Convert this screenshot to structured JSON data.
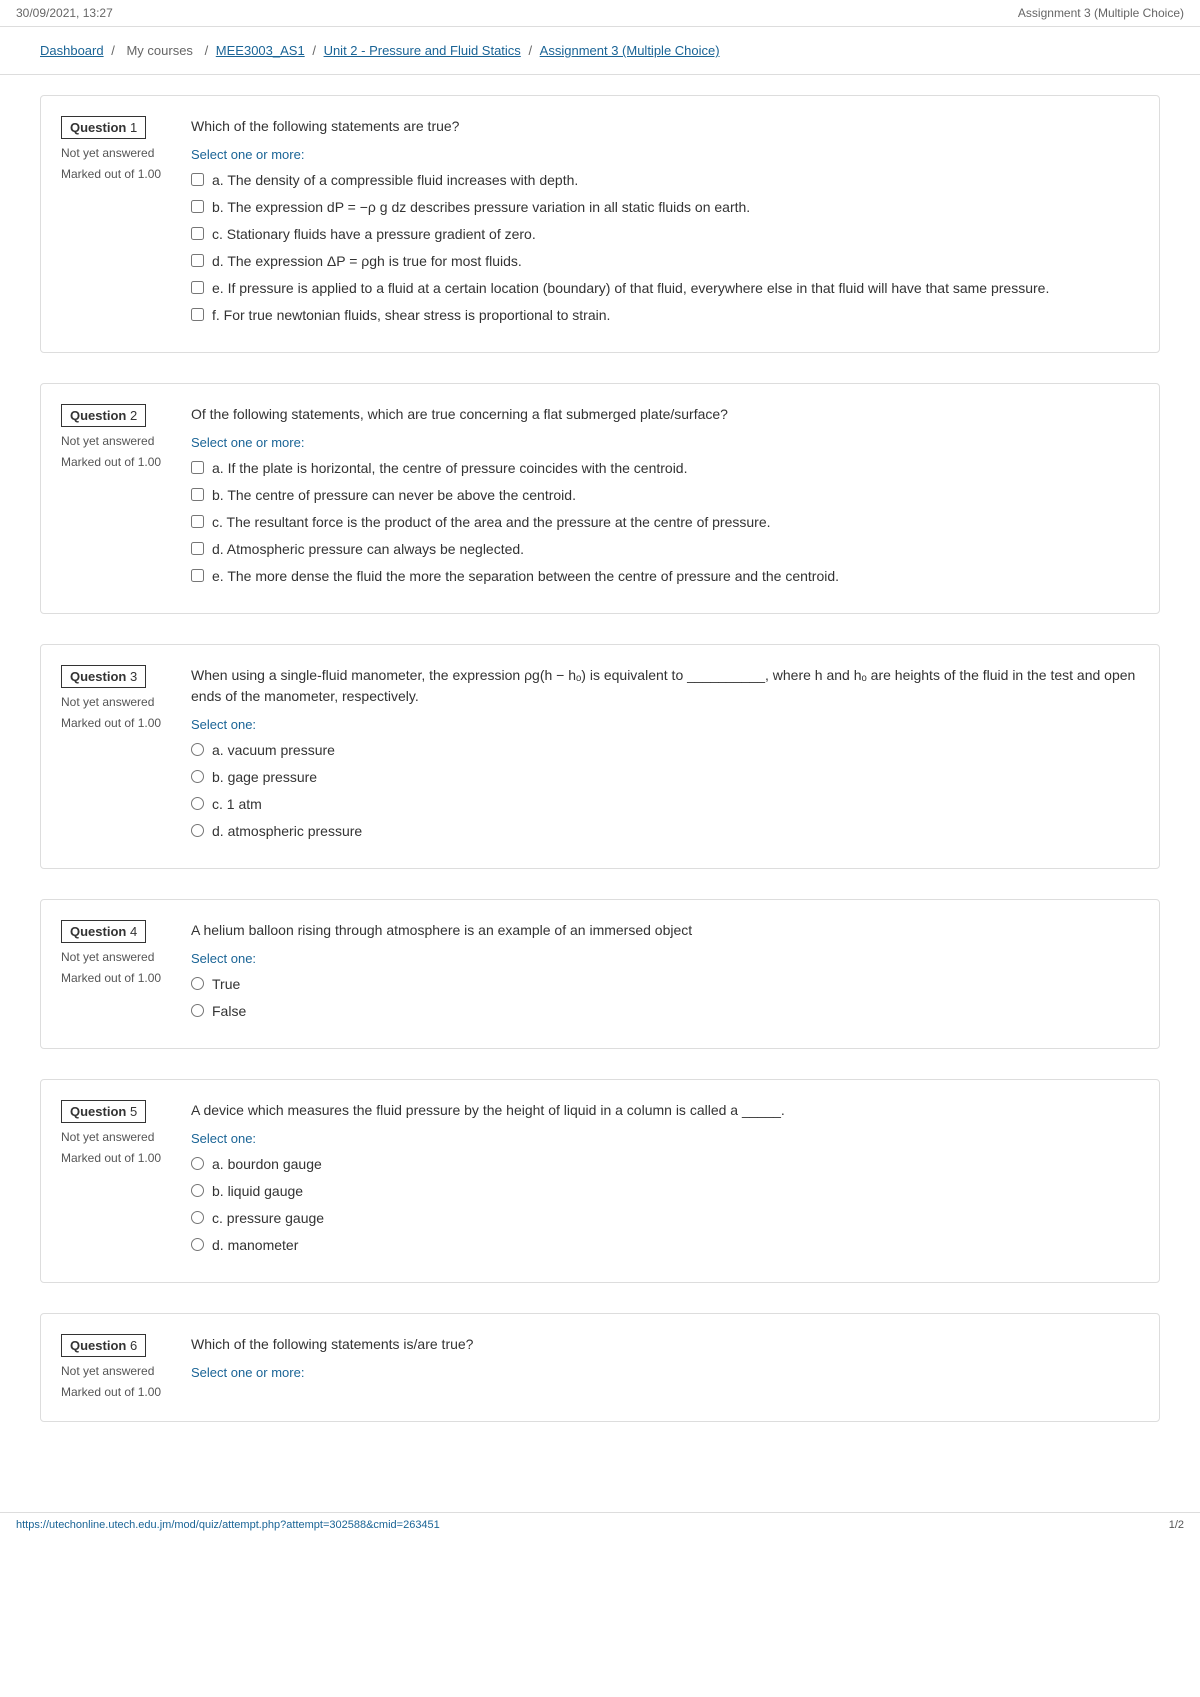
{
  "topbar": {
    "datetime": "30/09/2021, 13:27",
    "title": "Assignment 3 (Multiple Choice)"
  },
  "breadcrumb": {
    "items": [
      {
        "label": "Dashboard",
        "url": "#"
      },
      {
        "label": "My courses",
        "url": "#"
      },
      {
        "label": "MEE3003_AS1",
        "url": "#"
      },
      {
        "label": "Unit 2 - Pressure and Fluid Statics",
        "url": "#"
      },
      {
        "label": "Assignment 3 (Multiple Choice)",
        "url": "#"
      }
    ],
    "separators": [
      "/",
      "/",
      "/",
      "/"
    ]
  },
  "questions": [
    {
      "number": "1",
      "label": "Question 1",
      "status": "Not yet answered",
      "mark": "Marked out of 1.00",
      "type": "checkbox",
      "select_label": "Select one or more:",
      "text": "Which of the following statements are true?",
      "options": [
        "a. The density of a compressible fluid increases with depth.",
        "b. The expression dP = −ρ g dz describes pressure variation in all static fluids on earth.",
        "c. Stationary fluids have a pressure gradient of zero.",
        "d. The expression ΔP = ρgh is true for most fluids.",
        "e. If pressure is applied to a fluid at a certain location (boundary) of that fluid, everywhere else in that fluid will have that same pressure.",
        "f. For true newtonian fluids, shear stress is proportional to strain."
      ]
    },
    {
      "number": "2",
      "label": "Question 2",
      "status": "Not yet answered",
      "mark": "Marked out of 1.00",
      "type": "checkbox",
      "select_label": "Select one or more:",
      "text": "Of the following statements, which are true concerning a flat submerged plate/surface?",
      "options": [
        "a. If the plate is horizontal, the centre of pressure coincides with the centroid.",
        "b. The centre of pressure can never be above the centroid.",
        "c. The resultant force is the product of the area and the pressure at the centre of pressure.",
        "d. Atmospheric pressure can always be neglected.",
        "e. The more dense the fluid the more the separation between the centre of pressure and the centroid."
      ]
    },
    {
      "number": "3",
      "label": "Question 3",
      "status": "Not yet answered",
      "mark": "Marked out of 1.00",
      "type": "radio",
      "select_label": "Select one:",
      "text": "When using a single-fluid manometer, the expression ρg(h − hₒ) is equivalent to __________, where h and hₒ are heights of the fluid in the test and open ends of the manometer, respectively.",
      "options": [
        "a. vacuum pressure",
        "b. gage pressure",
        "c. 1 atm",
        "d. atmospheric pressure"
      ]
    },
    {
      "number": "4",
      "label": "Question 4",
      "status": "Not yet answered",
      "mark": "Marked out of 1.00",
      "type": "radio",
      "select_label": "Select one:",
      "text": "A helium balloon rising through atmosphere is an example of an immersed object",
      "options": [
        "True",
        "False"
      ]
    },
    {
      "number": "5",
      "label": "Question 5",
      "status": "Not yet answered",
      "mark": "Marked out of 1.00",
      "type": "radio",
      "select_label": "Select one:",
      "text": "A device which measures the fluid pressure by the height of liquid in a column is called a _____.",
      "options": [
        "a. bourdon gauge",
        "b. liquid gauge",
        "c. pressure gauge",
        "d. manometer"
      ]
    },
    {
      "number": "6",
      "label": "Question 6",
      "status": "Not yet answered",
      "mark": "Marked out of 1.00",
      "type": "checkbox",
      "select_label": "Select one or more:",
      "text": "Which of the following statements is/are true?",
      "options": []
    }
  ],
  "bottombar": {
    "url": "https://utechonline.utech.edu.jm/mod/quiz/attempt.php?attempt=302588&cmid=263451",
    "page": "1/2"
  }
}
